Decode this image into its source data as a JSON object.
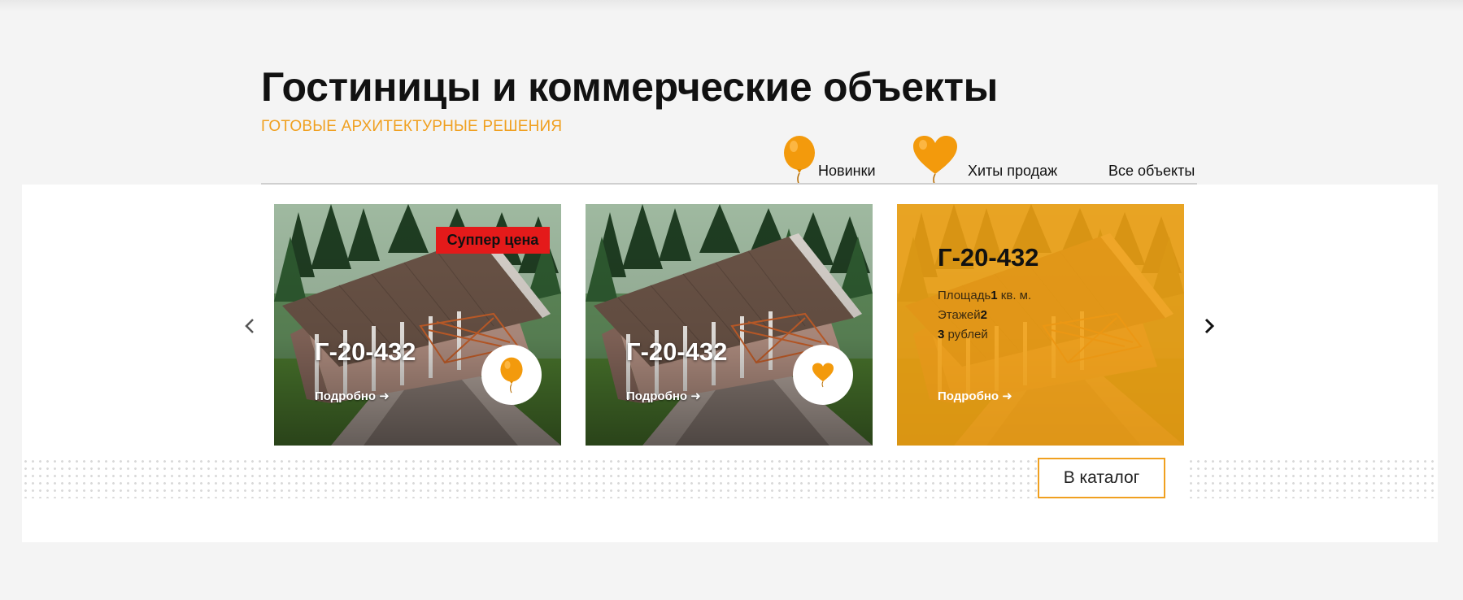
{
  "section": {
    "title": "Гостиницы и коммерческие объекты",
    "subtitle": "ГОТОВЫЕ АРХИТЕКТУРНЫЕ РЕШЕНИЯ"
  },
  "tabs": [
    {
      "label": "Новинки",
      "icon": "balloon-icon"
    },
    {
      "label": "Хиты продаж",
      "icon": "heart-balloon-icon"
    },
    {
      "label": "Все объекты",
      "icon": ""
    }
  ],
  "cards": [
    {
      "name": "Г-20-432",
      "link_label": "Подробно",
      "badge": "Суппер цена",
      "marker_icon": "balloon-icon"
    },
    {
      "name": "Г-20-432",
      "link_label": "Подробно",
      "marker_icon": "heart-balloon-icon"
    },
    {
      "name": "Г-20-432",
      "area_label": "Площадь",
      "area_value": "1",
      "area_unit": " кв. м.",
      "floors_label": "Этажей",
      "floors_value": "2",
      "price_value": "3",
      "price_unit": " рублей",
      "link_label": "Подробно"
    }
  ],
  "carousel": {
    "prev_icon": "chevron-left-icon",
    "next_icon": "chevron-right-icon"
  },
  "catalog_button": "В каталог",
  "colors": {
    "accent": "#f0a020",
    "badge": "#e41a1a",
    "overlay": "#f3a012"
  }
}
